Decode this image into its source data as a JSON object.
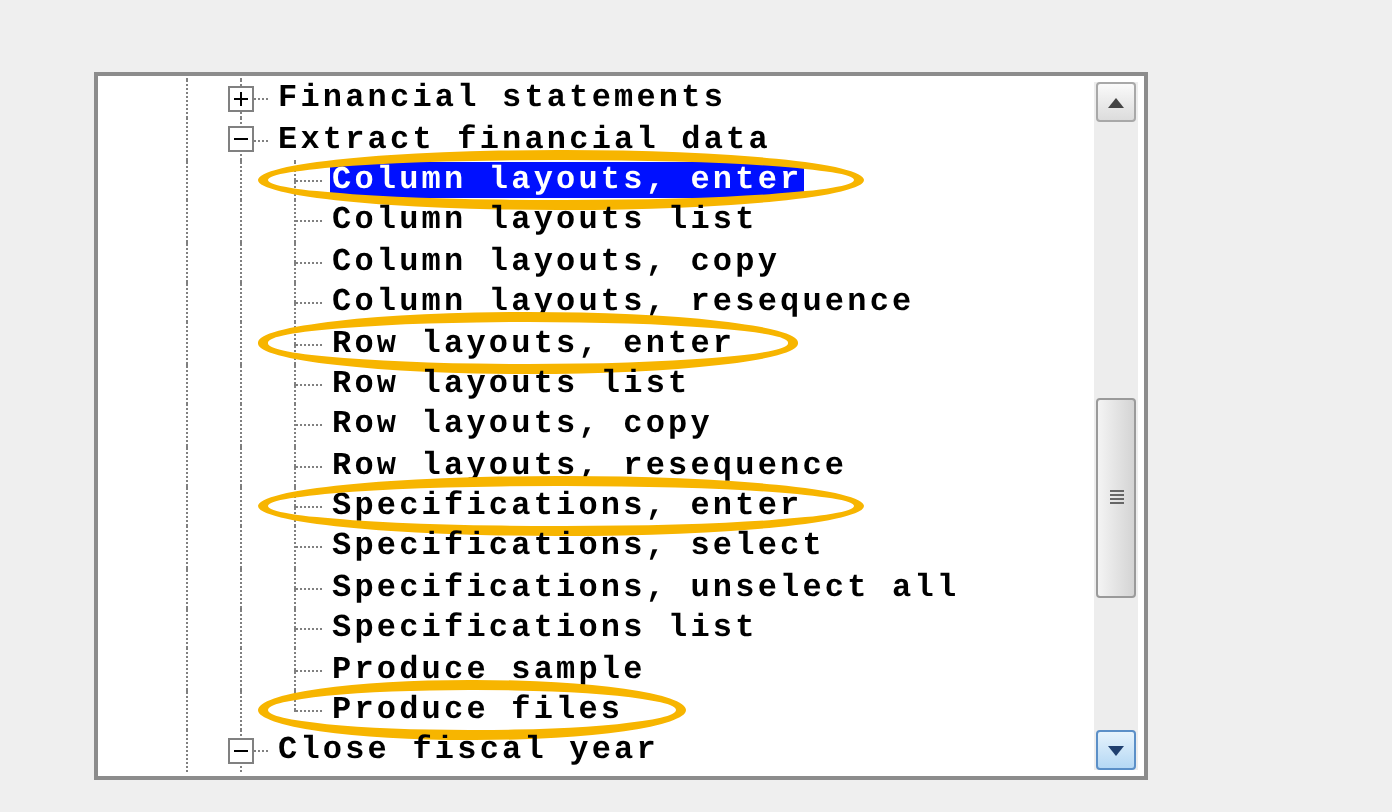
{
  "tree": [
    {
      "label": "Financial statements",
      "expanded": false,
      "circled": false,
      "selected": false
    },
    {
      "label": "Extract financial data",
      "expanded": true,
      "circled": false,
      "selected": false,
      "children": [
        {
          "label": "Column layouts, enter",
          "selected": true,
          "circled": true
        },
        {
          "label": "Column layouts list",
          "selected": false,
          "circled": false
        },
        {
          "label": "Column layouts, copy",
          "selected": false,
          "circled": false
        },
        {
          "label": "Column layouts, resequence",
          "selected": false,
          "circled": false
        },
        {
          "label": "Row layouts, enter",
          "selected": false,
          "circled": true
        },
        {
          "label": "Row layouts list",
          "selected": false,
          "circled": false
        },
        {
          "label": "Row layouts, copy",
          "selected": false,
          "circled": false
        },
        {
          "label": "Row layouts, resequence",
          "selected": false,
          "circled": false
        },
        {
          "label": "Specifications, enter",
          "selected": false,
          "circled": true
        },
        {
          "label": "Specifications, select",
          "selected": false,
          "circled": false
        },
        {
          "label": "Specifications, unselect all",
          "selected": false,
          "circled": false
        },
        {
          "label": "Specifications list",
          "selected": false,
          "circled": false
        },
        {
          "label": "Produce sample",
          "selected": false,
          "circled": false
        },
        {
          "label": "Produce files",
          "selected": false,
          "circled": true
        }
      ]
    },
    {
      "label": "Close fiscal year",
      "expanded": true,
      "circled": false,
      "selected": false
    }
  ]
}
